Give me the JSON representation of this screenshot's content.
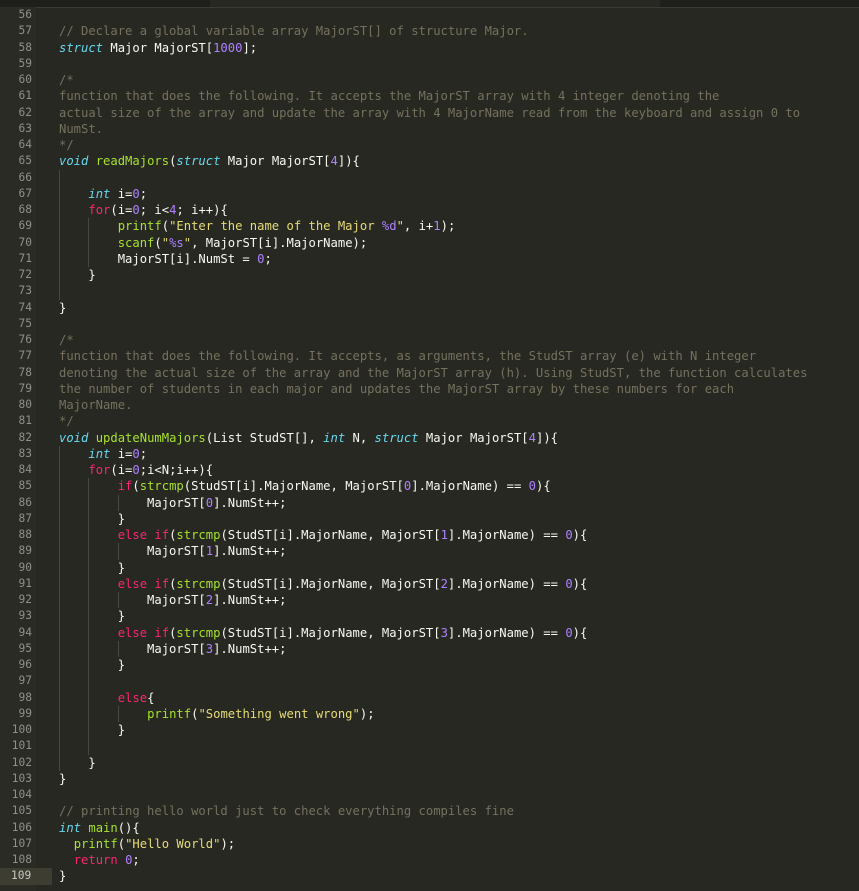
{
  "editor": {
    "theme": {
      "background": "#272822",
      "comment": "#75715e",
      "keyword": "#f92672",
      "type": "#66d9ef",
      "function": "#a6e22e",
      "string": "#e6db74",
      "number": "#ae81ff",
      "text": "#f8f8f2"
    },
    "current_line": 109,
    "lines": [
      {
        "n": "56",
        "i": 0,
        "t": []
      },
      {
        "n": "57",
        "i": 0,
        "t": [
          [
            "c",
            "// Declare a global variable array MajorST[] of structure Major."
          ]
        ]
      },
      {
        "n": "58",
        "i": 0,
        "t": [
          [
            "t",
            "struct"
          ],
          [
            "p",
            " Major MajorST["
          ],
          [
            "n",
            "1000"
          ],
          [
            "p",
            "];"
          ]
        ]
      },
      {
        "n": "59",
        "i": 0,
        "t": []
      },
      {
        "n": "60",
        "i": 0,
        "t": [
          [
            "c",
            "/*"
          ]
        ]
      },
      {
        "n": "61",
        "i": 0,
        "t": [
          [
            "c",
            "function that does the following. It accepts the MajorST array with 4 integer denoting the"
          ]
        ]
      },
      {
        "n": "62",
        "i": 0,
        "t": [
          [
            "c",
            "actual size of the array and update the array with 4 MajorName read from the keyboard and assign 0 to"
          ]
        ]
      },
      {
        "n": "63",
        "i": 0,
        "t": [
          [
            "c",
            "NumSt."
          ]
        ]
      },
      {
        "n": "64",
        "i": 0,
        "t": [
          [
            "c",
            "*/"
          ]
        ]
      },
      {
        "n": "65",
        "i": 0,
        "t": [
          [
            "t",
            "void"
          ],
          [
            "p",
            " "
          ],
          [
            "f",
            "readMajors"
          ],
          [
            "p",
            "("
          ],
          [
            "t",
            "struct"
          ],
          [
            "p",
            " Major MajorST["
          ],
          [
            "n",
            "4"
          ],
          [
            "p",
            "]){"
          ]
        ]
      },
      {
        "n": "66",
        "i": 1,
        "t": []
      },
      {
        "n": "67",
        "i": 1,
        "t": [
          [
            "p",
            "    "
          ],
          [
            "t",
            "int"
          ],
          [
            "p",
            " i="
          ],
          [
            "n",
            "0"
          ],
          [
            "p",
            ";"
          ]
        ]
      },
      {
        "n": "68",
        "i": 1,
        "t": [
          [
            "p",
            "    "
          ],
          [
            "k",
            "for"
          ],
          [
            "p",
            "(i="
          ],
          [
            "n",
            "0"
          ],
          [
            "p",
            "; i<"
          ],
          [
            "n",
            "4"
          ],
          [
            "p",
            "; i++){"
          ]
        ]
      },
      {
        "n": "69",
        "i": 2,
        "t": [
          [
            "p",
            "        "
          ],
          [
            "f",
            "printf"
          ],
          [
            "p",
            "("
          ],
          [
            "s",
            "\"Enter the name of the Major "
          ],
          [
            "fmt",
            "%d"
          ],
          [
            "s",
            "\""
          ],
          [
            "p",
            ", i+"
          ],
          [
            "n",
            "1"
          ],
          [
            "p",
            ");"
          ]
        ]
      },
      {
        "n": "70",
        "i": 2,
        "t": [
          [
            "p",
            "        "
          ],
          [
            "f",
            "scanf"
          ],
          [
            "p",
            "("
          ],
          [
            "s",
            "\""
          ],
          [
            "fmt",
            "%s"
          ],
          [
            "s",
            "\""
          ],
          [
            "p",
            ", MajorST[i].MajorName);"
          ]
        ]
      },
      {
        "n": "71",
        "i": 2,
        "t": [
          [
            "p",
            "        MajorST[i].NumSt = "
          ],
          [
            "n",
            "0"
          ],
          [
            "p",
            ";"
          ]
        ]
      },
      {
        "n": "72",
        "i": 1,
        "t": [
          [
            "p",
            "    }"
          ]
        ]
      },
      {
        "n": "73",
        "i": 1,
        "t": []
      },
      {
        "n": "74",
        "i": 0,
        "t": [
          [
            "p",
            "}"
          ]
        ]
      },
      {
        "n": "75",
        "i": 0,
        "t": []
      },
      {
        "n": "76",
        "i": 0,
        "t": [
          [
            "c",
            "/*"
          ]
        ]
      },
      {
        "n": "77",
        "i": 0,
        "t": [
          [
            "c",
            "function that does the following. It accepts, as arguments, the StudST array (e) with N integer"
          ]
        ]
      },
      {
        "n": "78",
        "i": 0,
        "t": [
          [
            "c",
            "denoting the actual size of the array and the MajorST array (h). Using StudST, the function calculates"
          ]
        ]
      },
      {
        "n": "79",
        "i": 0,
        "t": [
          [
            "c",
            "the number of students in each major and updates the MajorST array by these numbers for each"
          ]
        ]
      },
      {
        "n": "80",
        "i": 0,
        "t": [
          [
            "c",
            "MajorName."
          ]
        ]
      },
      {
        "n": "81",
        "i": 0,
        "t": [
          [
            "c",
            "*/"
          ]
        ]
      },
      {
        "n": "82",
        "i": 0,
        "t": [
          [
            "t",
            "void"
          ],
          [
            "p",
            " "
          ],
          [
            "f",
            "updateNumMajors"
          ],
          [
            "p",
            "(List StudST[], "
          ],
          [
            "t",
            "int"
          ],
          [
            "p",
            " N, "
          ],
          [
            "t",
            "struct"
          ],
          [
            "p",
            " Major MajorST["
          ],
          [
            "n",
            "4"
          ],
          [
            "p",
            "]){"
          ]
        ]
      },
      {
        "n": "83",
        "i": 1,
        "t": [
          [
            "p",
            "    "
          ],
          [
            "t",
            "int"
          ],
          [
            "p",
            " i="
          ],
          [
            "n",
            "0"
          ],
          [
            "p",
            ";"
          ]
        ]
      },
      {
        "n": "84",
        "i": 1,
        "t": [
          [
            "p",
            "    "
          ],
          [
            "k",
            "for"
          ],
          [
            "p",
            "(i="
          ],
          [
            "n",
            "0"
          ],
          [
            "p",
            ";i<N;i++){"
          ]
        ]
      },
      {
        "n": "85",
        "i": 2,
        "t": [
          [
            "p",
            "        "
          ],
          [
            "k",
            "if"
          ],
          [
            "p",
            "("
          ],
          [
            "f",
            "strcmp"
          ],
          [
            "p",
            "(StudST[i].MajorName, MajorST["
          ],
          [
            "n",
            "0"
          ],
          [
            "p",
            "].MajorName) == "
          ],
          [
            "n",
            "0"
          ],
          [
            "p",
            "){"
          ]
        ]
      },
      {
        "n": "86",
        "i": 3,
        "t": [
          [
            "p",
            "            MajorST["
          ],
          [
            "n",
            "0"
          ],
          [
            "p",
            "].NumSt++;"
          ]
        ]
      },
      {
        "n": "87",
        "i": 2,
        "t": [
          [
            "p",
            "        }"
          ]
        ]
      },
      {
        "n": "88",
        "i": 2,
        "t": [
          [
            "p",
            "        "
          ],
          [
            "k",
            "else if"
          ],
          [
            "p",
            "("
          ],
          [
            "f",
            "strcmp"
          ],
          [
            "p",
            "(StudST[i].MajorName, MajorST["
          ],
          [
            "n",
            "1"
          ],
          [
            "p",
            "].MajorName) == "
          ],
          [
            "n",
            "0"
          ],
          [
            "p",
            "){"
          ]
        ]
      },
      {
        "n": "89",
        "i": 3,
        "t": [
          [
            "p",
            "            MajorST["
          ],
          [
            "n",
            "1"
          ],
          [
            "p",
            "].NumSt++;"
          ]
        ]
      },
      {
        "n": "90",
        "i": 2,
        "t": [
          [
            "p",
            "        }"
          ]
        ]
      },
      {
        "n": "91",
        "i": 2,
        "t": [
          [
            "p",
            "        "
          ],
          [
            "k",
            "else if"
          ],
          [
            "p",
            "("
          ],
          [
            "f",
            "strcmp"
          ],
          [
            "p",
            "(StudST[i].MajorName, MajorST["
          ],
          [
            "n",
            "2"
          ],
          [
            "p",
            "].MajorName) == "
          ],
          [
            "n",
            "0"
          ],
          [
            "p",
            "){"
          ]
        ]
      },
      {
        "n": "92",
        "i": 3,
        "t": [
          [
            "p",
            "            MajorST["
          ],
          [
            "n",
            "2"
          ],
          [
            "p",
            "].NumSt++;"
          ]
        ]
      },
      {
        "n": "93",
        "i": 2,
        "t": [
          [
            "p",
            "        }"
          ]
        ]
      },
      {
        "n": "94",
        "i": 2,
        "t": [
          [
            "p",
            "        "
          ],
          [
            "k",
            "else if"
          ],
          [
            "p",
            "("
          ],
          [
            "f",
            "strcmp"
          ],
          [
            "p",
            "(StudST[i].MajorName, MajorST["
          ],
          [
            "n",
            "3"
          ],
          [
            "p",
            "].MajorName) == "
          ],
          [
            "n",
            "0"
          ],
          [
            "p",
            "){"
          ]
        ]
      },
      {
        "n": "95",
        "i": 3,
        "t": [
          [
            "p",
            "            MajorST["
          ],
          [
            "n",
            "3"
          ],
          [
            "p",
            "].NumSt++;"
          ]
        ]
      },
      {
        "n": "96",
        "i": 2,
        "t": [
          [
            "p",
            "        }"
          ]
        ]
      },
      {
        "n": "97",
        "i": 2,
        "t": []
      },
      {
        "n": "98",
        "i": 2,
        "t": [
          [
            "p",
            "        "
          ],
          [
            "k",
            "else"
          ],
          [
            "p",
            "{"
          ]
        ]
      },
      {
        "n": "99",
        "i": 3,
        "t": [
          [
            "p",
            "            "
          ],
          [
            "f",
            "printf"
          ],
          [
            "p",
            "("
          ],
          [
            "s",
            "\"Something went wrong\""
          ],
          [
            "p",
            ");"
          ]
        ]
      },
      {
        "n": "100",
        "i": 2,
        "t": [
          [
            "p",
            "        }"
          ]
        ]
      },
      {
        "n": "101",
        "i": 2,
        "t": []
      },
      {
        "n": "102",
        "i": 1,
        "t": [
          [
            "p",
            "    }"
          ]
        ]
      },
      {
        "n": "103",
        "i": 0,
        "t": [
          [
            "p",
            "}"
          ]
        ]
      },
      {
        "n": "104",
        "i": 0,
        "t": []
      },
      {
        "n": "105",
        "i": 0,
        "t": [
          [
            "c",
            "// printing hello world just to check everything compiles fine"
          ]
        ]
      },
      {
        "n": "106",
        "i": 0,
        "t": [
          [
            "t",
            "int"
          ],
          [
            "p",
            " "
          ],
          [
            "f",
            "main"
          ],
          [
            "p",
            "(){"
          ]
        ]
      },
      {
        "n": "107",
        "i": 0,
        "t": [
          [
            "p",
            "  "
          ],
          [
            "f",
            "printf"
          ],
          [
            "p",
            "("
          ],
          [
            "s",
            "\"Hello World\""
          ],
          [
            "p",
            ");"
          ]
        ]
      },
      {
        "n": "108",
        "i": 0,
        "t": [
          [
            "p",
            "  "
          ],
          [
            "k",
            "return"
          ],
          [
            "p",
            " "
          ],
          [
            "n",
            "0"
          ],
          [
            "p",
            ";"
          ]
        ]
      },
      {
        "n": "109",
        "i": 0,
        "t": [
          [
            "p",
            "}"
          ]
        ]
      }
    ]
  }
}
